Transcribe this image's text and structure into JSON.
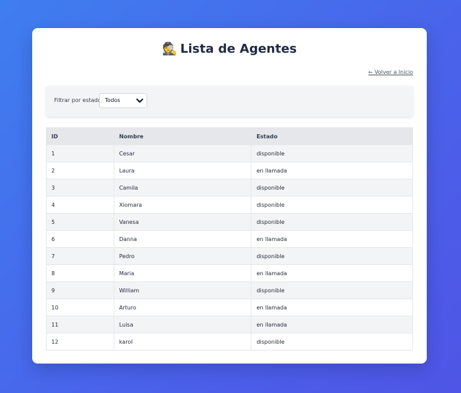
{
  "page": {
    "title": "Lista de Agentes",
    "title_icon": "🕵️",
    "back_link": "← Volver a Inicio"
  },
  "filter": {
    "label": "Filtrar por estado:",
    "selected": "Todos"
  },
  "table": {
    "headers": [
      "ID",
      "Nombre",
      "Estado"
    ],
    "rows": [
      {
        "id": "1",
        "nombre": "Cesar",
        "estado": "disponible"
      },
      {
        "id": "2",
        "nombre": "Laura",
        "estado": "en llamada"
      },
      {
        "id": "3",
        "nombre": "Camila",
        "estado": "disponible"
      },
      {
        "id": "4",
        "nombre": "Xiomara",
        "estado": "disponible"
      },
      {
        "id": "5",
        "nombre": "Vanesa",
        "estado": "disponible"
      },
      {
        "id": "6",
        "nombre": "Danna",
        "estado": "en llamada"
      },
      {
        "id": "7",
        "nombre": "Pedro",
        "estado": "disponible"
      },
      {
        "id": "8",
        "nombre": "Maria",
        "estado": "en llamada"
      },
      {
        "id": "9",
        "nombre": "William",
        "estado": "disponible"
      },
      {
        "id": "10",
        "nombre": "Arturo",
        "estado": "en llamada"
      },
      {
        "id": "11",
        "nombre": "Luisa",
        "estado": "en llamada"
      },
      {
        "id": "12",
        "nombre": "karol",
        "estado": "disponible"
      }
    ]
  },
  "colors": {
    "background_start": "#3f7ef0",
    "background_end": "#4f55e6",
    "header_bg": "#e5e7eb",
    "stripe_bg": "#f3f4f6"
  }
}
